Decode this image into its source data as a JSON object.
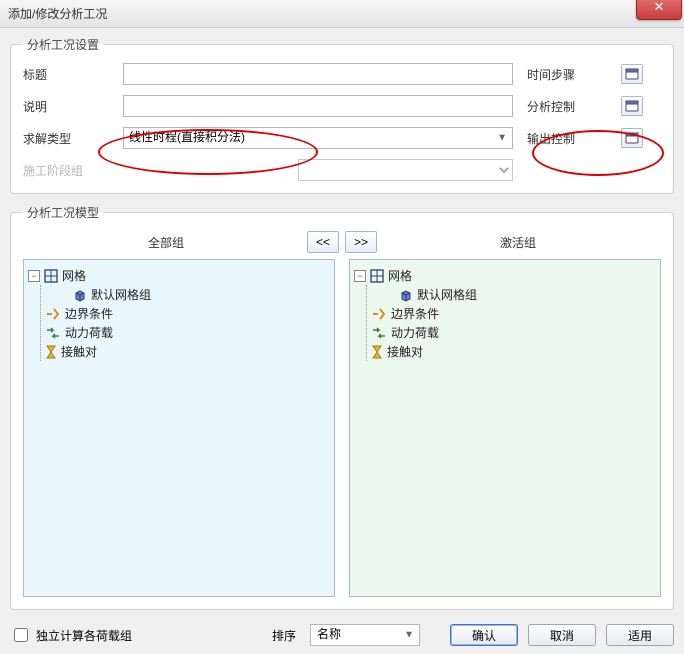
{
  "window": {
    "title": "添加/修改分析工况"
  },
  "settings": {
    "legend": "分析工况设置",
    "labels": {
      "title": "标题",
      "description": "说明",
      "solverType": "求解类型",
      "stageGroup": "施工阶段组"
    },
    "values": {
      "title": "",
      "description": "",
      "solverType": "线性时程(直接积分法)"
    },
    "side": {
      "timeStep": "时间步骤",
      "analysisCtrl": "分析控制",
      "outputCtrl": "输出控制"
    }
  },
  "model": {
    "legend": "分析工况模型",
    "allGroupsHeader": "全部组",
    "activeGroupsHeader": "激活组",
    "navPrev": "<<",
    "navNext": ">>",
    "tree": {
      "mesh": "网格",
      "defaultMeshGroup": "默认网格组",
      "boundary": "边界条件",
      "dynamicLoad": "动力荷载",
      "contactPair": "接触对"
    }
  },
  "footer": {
    "independentCalc": "独立计算各荷载组",
    "sortLabel": "排序",
    "sortValue": "名称",
    "ok": "确认",
    "cancel": "取消",
    "apply": "适用"
  }
}
